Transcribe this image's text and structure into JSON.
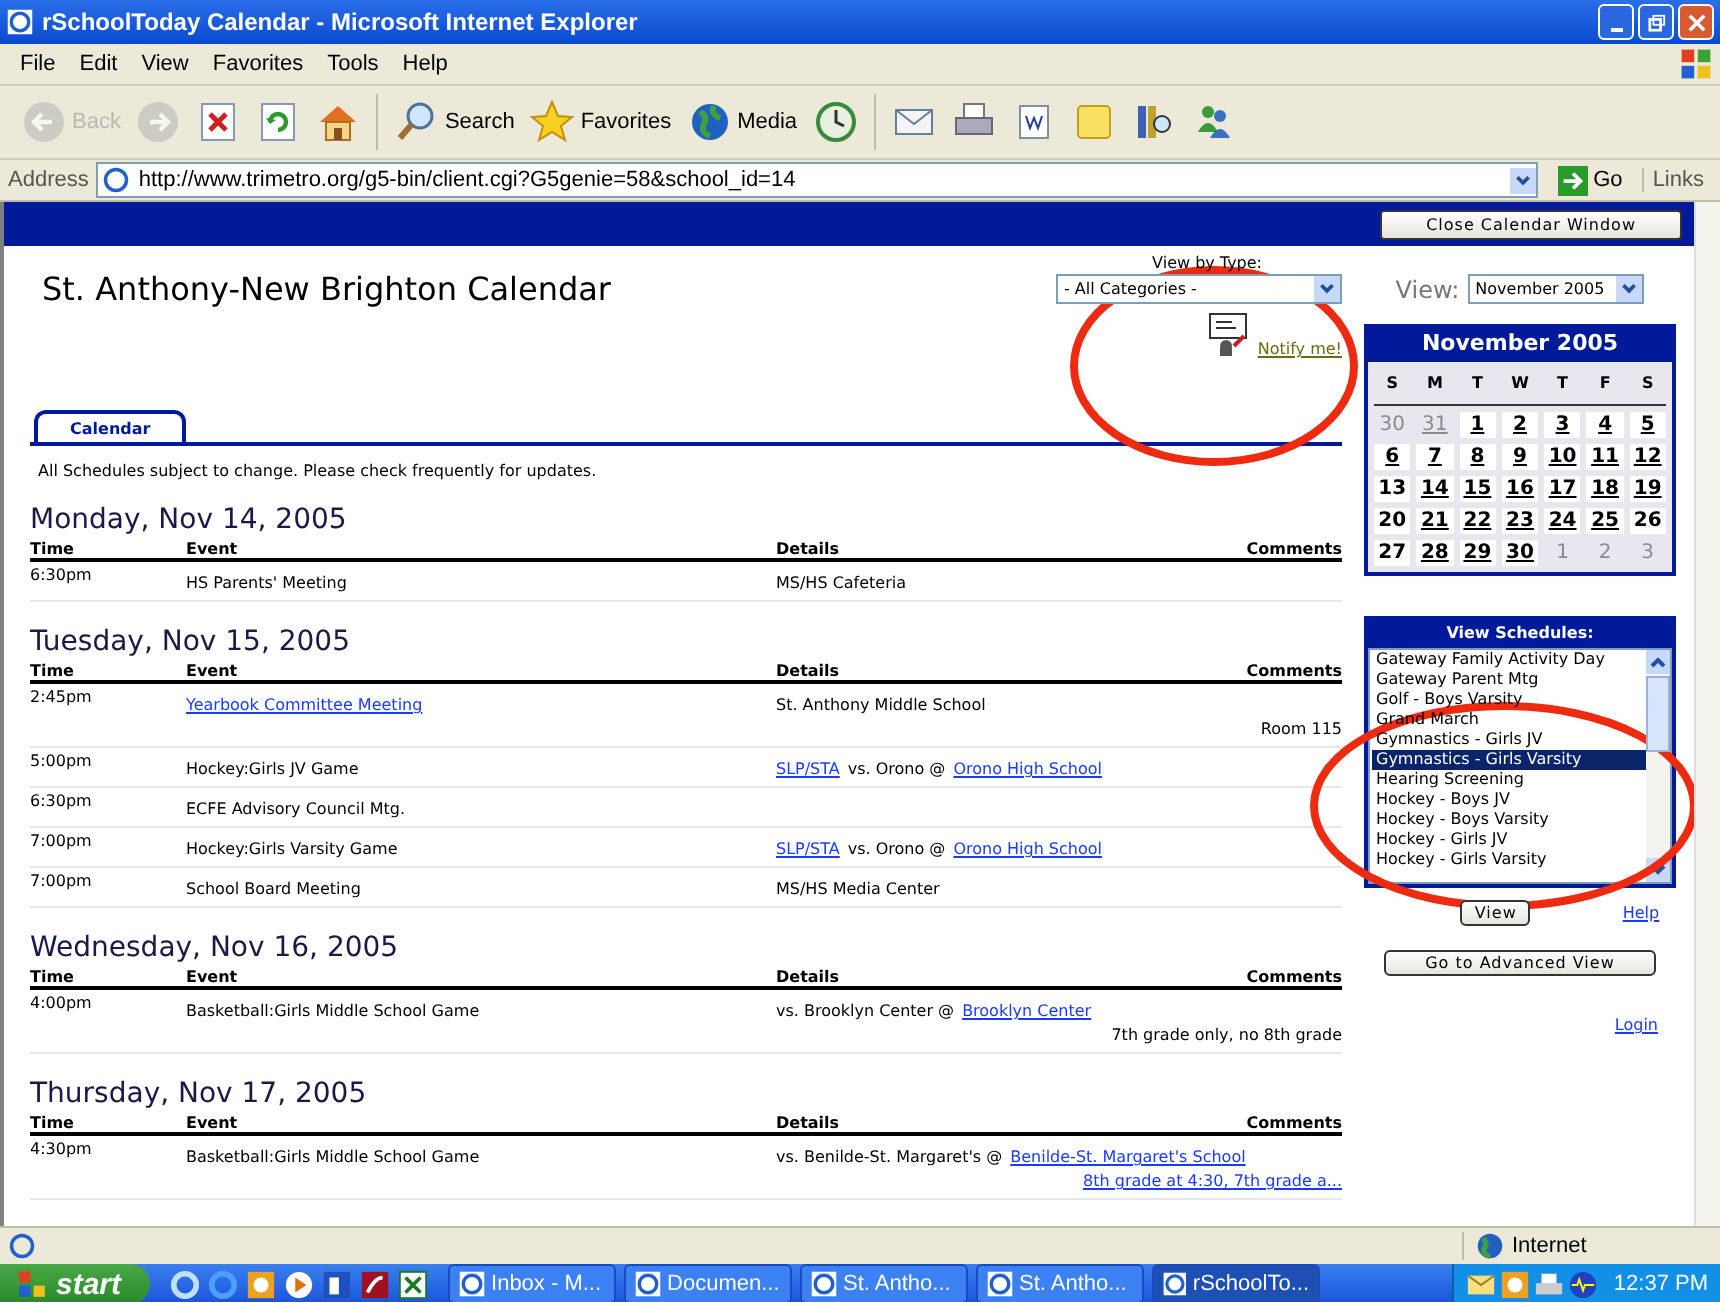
{
  "window": {
    "title": "rSchoolToday Calendar - Microsoft Internet Explorer"
  },
  "menu": [
    "File",
    "Edit",
    "View",
    "Favorites",
    "Tools",
    "Help"
  ],
  "toolbar": [
    {
      "kind": "back",
      "label": "Back",
      "disabled": true
    },
    {
      "kind": "forward",
      "disabled": true
    },
    {
      "kind": "stop",
      "disabled": false
    },
    {
      "kind": "refresh",
      "disabled": false
    },
    {
      "kind": "home",
      "disabled": false
    },
    {
      "kind": "search",
      "label": "Search",
      "disabled": false
    },
    {
      "kind": "favorites",
      "label": "Favorites",
      "disabled": false
    },
    {
      "kind": "media",
      "label": "Media",
      "disabled": false
    },
    {
      "kind": "history",
      "disabled": false
    },
    {
      "kind": "mail",
      "disabled": false
    },
    {
      "kind": "print",
      "disabled": false
    },
    {
      "kind": "edit",
      "disabled": false
    },
    {
      "kind": "notes",
      "disabled": false
    },
    {
      "kind": "research",
      "disabled": false
    },
    {
      "kind": "messenger",
      "disabled": false
    }
  ],
  "address_bar": {
    "label": "Address",
    "url": "http://www.trimetro.org/g5-bin/client.cgi?G5genie=58&school_id=14",
    "go": "Go",
    "links": "Links"
  },
  "page": {
    "close_button": "Close Calendar Window",
    "title": "St. Anthony-New Brighton Calendar",
    "type_filter": {
      "label": "View by Type:",
      "value": "- All Categories -"
    },
    "notify_link": "Notify me!",
    "tabs": [
      {
        "label": "Calendar",
        "selected": true
      }
    ],
    "notice": "All Schedules subject to change. Please check frequently for updates.",
    "days": [
      {
        "heading": "Monday, Nov 14, 2005",
        "columns": [
          "Time",
          "Event",
          "Details",
          "Comments"
        ],
        "events": [
          {
            "time": "6:30pm",
            "event": {
              "text": "HS Parents' Meeting",
              "link": false
            },
            "details": [
              {
                "text": "MS/HS Cafeteria",
                "link": false
              }
            ]
          }
        ]
      },
      {
        "heading": "Tuesday, Nov 15, 2005",
        "columns": [
          "Time",
          "Event",
          "Details",
          "Comments"
        ],
        "events": [
          {
            "time": "2:45pm",
            "event": {
              "text": "Yearbook Committee Meeting",
              "link": true
            },
            "details": [
              {
                "text": "St. Anthony Middle School",
                "link": false
              }
            ],
            "comment": {
              "text": "Room 115",
              "link": false
            }
          },
          {
            "time": "5:00pm",
            "event": {
              "text": "Hockey:Girls JV Game",
              "link": false
            },
            "details": [
              {
                "text": "SLP/STA",
                "link": true
              },
              {
                "text": "vs. Orono @",
                "link": false
              },
              {
                "text": "Orono High School",
                "link": true
              }
            ]
          },
          {
            "time": "6:30pm",
            "event": {
              "text": "ECFE Advisory Council Mtg.",
              "link": false
            }
          },
          {
            "time": "7:00pm",
            "event": {
              "text": "Hockey:Girls Varsity Game",
              "link": false
            },
            "details": [
              {
                "text": "SLP/STA",
                "link": true
              },
              {
                "text": "vs. Orono @",
                "link": false
              },
              {
                "text": "Orono High School",
                "link": true
              }
            ]
          },
          {
            "time": "7:00pm",
            "event": {
              "text": "School Board Meeting",
              "link": false
            },
            "details": [
              {
                "text": "MS/HS Media Center",
                "link": false
              }
            ]
          }
        ]
      },
      {
        "heading": "Wednesday, Nov 16, 2005",
        "columns": [
          "Time",
          "Event",
          "Details",
          "Comments"
        ],
        "events": [
          {
            "time": "4:00pm",
            "event": {
              "text": "Basketball:Girls Middle School Game",
              "link": false
            },
            "details": [
              {
                "text": "vs. Brooklyn Center @",
                "link": false
              },
              {
                "text": "Brooklyn Center",
                "link": true
              }
            ],
            "comment": {
              "text": "7th grade only, no 8th grade",
              "link": false
            }
          }
        ]
      },
      {
        "heading": "Thursday, Nov 17, 2005",
        "columns": [
          "Time",
          "Event",
          "Details",
          "Comments"
        ],
        "events": [
          {
            "time": "4:30pm",
            "event": {
              "text": "Basketball:Girls Middle School Game",
              "link": false
            },
            "details": [
              {
                "text": "vs. Benilde-St. Margaret's @",
                "link": false
              },
              {
                "text": "Benilde-St. Margaret's School",
                "link": true
              }
            ],
            "comment": {
              "text": "8th grade at 4:30, 7th grade a...",
              "link": true
            }
          }
        ]
      }
    ]
  },
  "sidebar": {
    "view_label": "View:",
    "month_select": "November 2005",
    "calendar": {
      "title": "November 2005",
      "weekdays": [
        "S",
        "M",
        "T",
        "W",
        "T",
        "F",
        "S"
      ],
      "weeks": [
        [
          {
            "day": "30",
            "in_month": false,
            "has_events": false
          },
          {
            "day": "31",
            "in_month": false,
            "has_events": true
          },
          {
            "day": "1",
            "in_month": true,
            "has_events": true
          },
          {
            "day": "2",
            "in_month": true,
            "has_events": true
          },
          {
            "day": "3",
            "in_month": true,
            "has_events": true
          },
          {
            "day": "4",
            "in_month": true,
            "has_events": true
          },
          {
            "day": "5",
            "in_month": true,
            "has_events": true
          }
        ],
        [
          {
            "day": "6",
            "in_month": true,
            "has_events": true
          },
          {
            "day": "7",
            "in_month": true,
            "has_events": true
          },
          {
            "day": "8",
            "in_month": true,
            "has_events": true
          },
          {
            "day": "9",
            "in_month": true,
            "has_events": true
          },
          {
            "day": "10",
            "in_month": true,
            "has_events": true
          },
          {
            "day": "11",
            "in_month": true,
            "has_events": true
          },
          {
            "day": "12",
            "in_month": true,
            "has_events": true
          }
        ],
        [
          {
            "day": "13",
            "in_month": true,
            "has_events": false
          },
          {
            "day": "14",
            "in_month": true,
            "has_events": true
          },
          {
            "day": "15",
            "in_month": true,
            "has_events": true
          },
          {
            "day": "16",
            "in_month": true,
            "has_events": true
          },
          {
            "day": "17",
            "in_month": true,
            "has_events": true
          },
          {
            "day": "18",
            "in_month": true,
            "has_events": true
          },
          {
            "day": "19",
            "in_month": true,
            "has_events": true
          }
        ],
        [
          {
            "day": "20",
            "in_month": true,
            "has_events": false
          },
          {
            "day": "21",
            "in_month": true,
            "has_events": true
          },
          {
            "day": "22",
            "in_month": true,
            "has_events": true
          },
          {
            "day": "23",
            "in_month": true,
            "has_events": true
          },
          {
            "day": "24",
            "in_month": true,
            "has_events": true
          },
          {
            "day": "25",
            "in_month": true,
            "has_events": true
          },
          {
            "day": "26",
            "in_month": true,
            "has_events": false
          }
        ],
        [
          {
            "day": "27",
            "in_month": true,
            "has_events": false
          },
          {
            "day": "28",
            "in_month": true,
            "has_events": true
          },
          {
            "day": "29",
            "in_month": true,
            "has_events": true
          },
          {
            "day": "30",
            "in_month": true,
            "has_events": true
          },
          {
            "day": "1",
            "in_month": false,
            "has_events": false
          },
          {
            "day": "2",
            "in_month": false,
            "has_events": false
          },
          {
            "day": "3",
            "in_month": false,
            "has_events": false
          }
        ]
      ]
    },
    "schedules": {
      "title": "View Schedules:",
      "items": [
        {
          "label": "Gateway Family Activity Day",
          "selected": false
        },
        {
          "label": "Gateway Parent Mtg",
          "selected": false
        },
        {
          "label": "Golf - Boys Varsity",
          "selected": false
        },
        {
          "label": "Grand March",
          "selected": false
        },
        {
          "label": "Gymnastics - Girls JV",
          "selected": false
        },
        {
          "label": "Gymnastics - Girls Varsity",
          "selected": true
        },
        {
          "label": "Hearing Screening",
          "selected": false
        },
        {
          "label": "Hockey - Boys JV",
          "selected": false
        },
        {
          "label": "Hockey - Boys Varsity",
          "selected": false
        },
        {
          "label": "Hockey - Girls JV",
          "selected": false
        },
        {
          "label": "Hockey - Girls Varsity",
          "selected": false
        }
      ]
    },
    "view_button": "View",
    "help_link": "Help",
    "advanced_button": "Go to Advanced View",
    "login_link": "Login"
  },
  "status_bar": {
    "zone": "Internet"
  },
  "taskbar": {
    "start": "start",
    "tasks": [
      {
        "label": "Inbox - M...",
        "selected": false
      },
      {
        "label": "Documen...",
        "selected": false
      },
      {
        "label": "St. Antho...",
        "selected": false
      },
      {
        "label": "St. Antho...",
        "selected": false
      },
      {
        "label": "rSchoolTo...",
        "selected": true
      }
    ],
    "clock": "12:37 PM"
  }
}
